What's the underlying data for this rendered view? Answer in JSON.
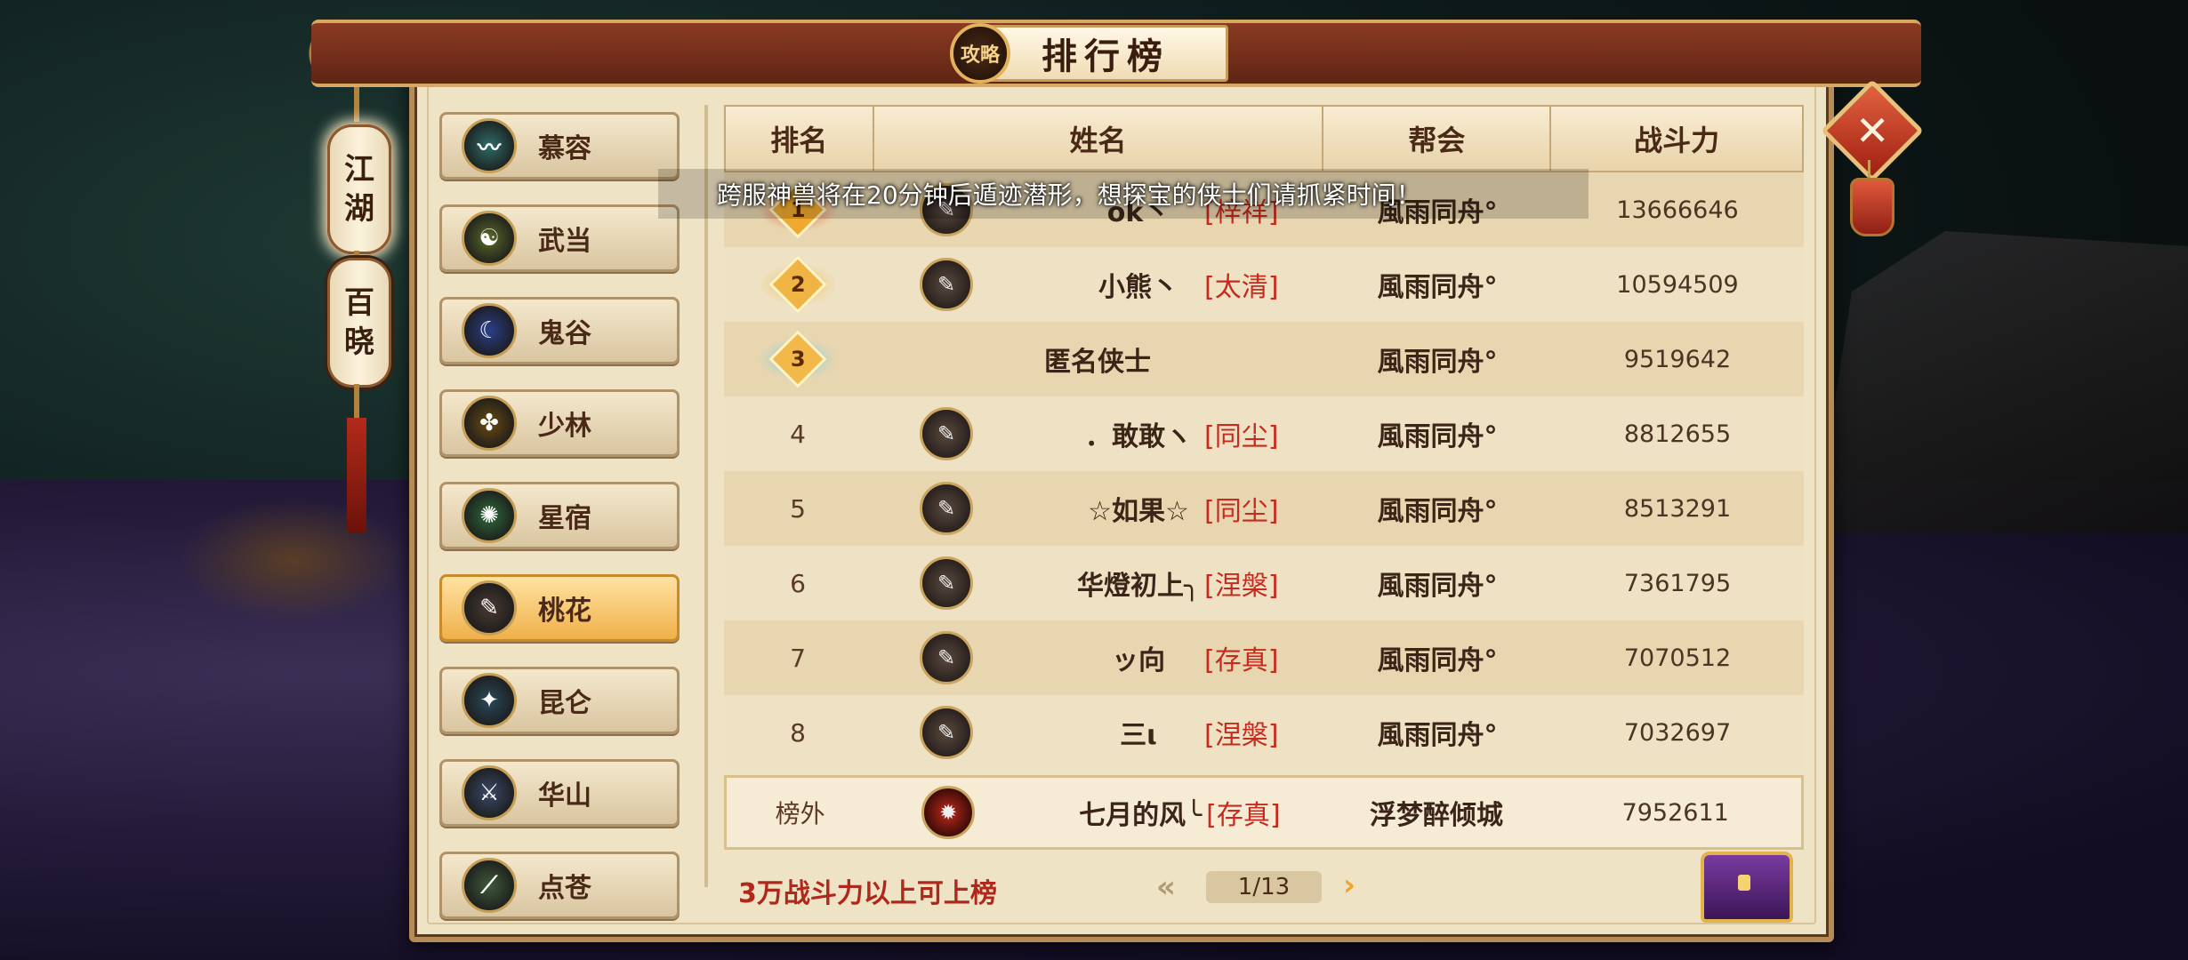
{
  "header": {
    "title": "排行榜",
    "medal_text": "攻略",
    "close_label": "✕"
  },
  "side_tabs": [
    {
      "label_top": "江",
      "label_bottom": "湖"
    },
    {
      "label_top": "百",
      "label_bottom": "晓"
    }
  ],
  "sects": [
    {
      "label": "慕容",
      "icon": "murong-emblem-icon",
      "color": "#2f6e6a",
      "glyph": "〰"
    },
    {
      "label": "武当",
      "icon": "wudang-emblem-icon",
      "color": "#5a6a2a",
      "glyph": "☯"
    },
    {
      "label": "鬼谷",
      "icon": "guigu-emblem-icon",
      "color": "#2a3f8a",
      "glyph": "☾"
    },
    {
      "label": "少林",
      "icon": "shaolin-emblem-icon",
      "color": "#6a4a12",
      "glyph": "✤"
    },
    {
      "label": "星宿",
      "icon": "xingxiu-emblem-icon",
      "color": "#2f6a3a",
      "glyph": "✺"
    },
    {
      "label": "桃花",
      "icon": "taohua-emblem-icon",
      "color": "#4a3a32",
      "glyph": "✎"
    },
    {
      "label": "昆仑",
      "icon": "kunlun-emblem-icon",
      "color": "#2a4a5a",
      "glyph": "✦"
    },
    {
      "label": "华山",
      "icon": "huashan-emblem-icon",
      "color": "#3a4a6a",
      "glyph": "⚔"
    },
    {
      "label": "点苍",
      "icon": "diancang-emblem-icon",
      "color": "#3f5a3a",
      "glyph": "⟋"
    }
  ],
  "active_sect": "桃花",
  "table": {
    "headers": {
      "rank": "排名",
      "name": "姓名",
      "guild": "帮会",
      "power": "战斗力"
    },
    "rows": [
      {
        "rank": "1",
        "name": "ok丶",
        "tag": "[梓祥]",
        "guild": "風雨同舟°",
        "power": "13666646"
      },
      {
        "rank": "2",
        "name": "小熊丶",
        "tag": "[太清]",
        "guild": "風雨同舟°",
        "power": "10594509"
      },
      {
        "rank": "3",
        "name": "匿名侠士",
        "tag": "",
        "guild": "風雨同舟°",
        "power": "9519642"
      },
      {
        "rank": "4",
        "name": "．敢敢ヽ",
        "tag": "[同尘]",
        "guild": "風雨同舟°",
        "power": "8812655"
      },
      {
        "rank": "5",
        "name": "☆如果☆",
        "tag": "[同尘]",
        "guild": "風雨同舟°",
        "power": "8513291"
      },
      {
        "rank": "6",
        "name": "华燈初上╮",
        "tag": "[涅槃]",
        "guild": "風雨同舟°",
        "power": "7361795"
      },
      {
        "rank": "7",
        "name": "ッ向",
        "tag": "[存真]",
        "guild": "風雨同舟°",
        "power": "7070512"
      },
      {
        "rank": "8",
        "name": "三ι",
        "tag": "[涅槃]",
        "guild": "風雨同舟°",
        "power": "7032697"
      }
    ],
    "self_row": {
      "rank": "榜外",
      "name": "七月的风╰",
      "tag": "[存真]",
      "guild": "浮梦醉倾城",
      "power": "7952611"
    }
  },
  "notice": "跨服神兽将在20分钟后遁迹潜形，想探宝的侠士们请抓紧时间！",
  "footer": {
    "tip": "3万战斗力以上可上榜",
    "page": "1/13",
    "prev": "«",
    "next": "›"
  },
  "colors": {
    "accent_red": "#c72a1e",
    "gold": "#e2b35c",
    "rank1": "#f0a92f",
    "rank2": "#f0b445",
    "rank3": "#f2b94a"
  }
}
